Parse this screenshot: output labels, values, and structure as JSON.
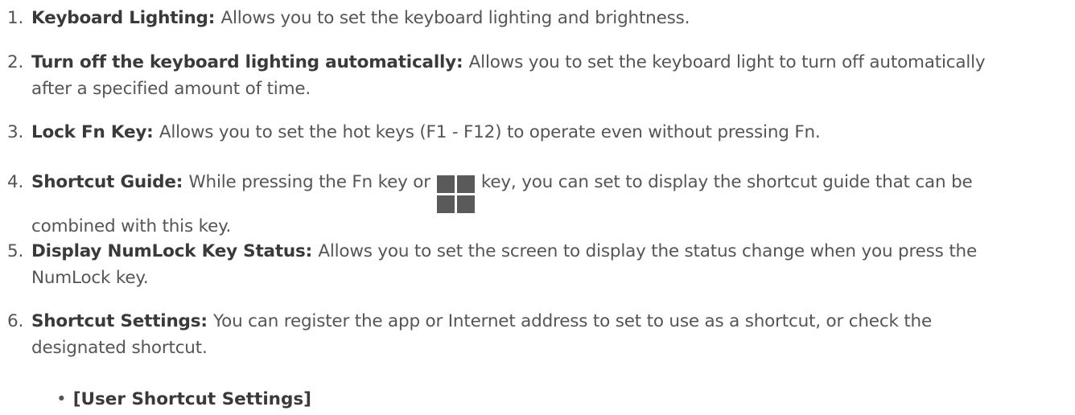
{
  "items": [
    {
      "num": "1.",
      "term": "Keyboard Lighting",
      "sep": ": ",
      "desc": "Allows you to set the keyboard lighting and brightness."
    },
    {
      "num": "2.",
      "term": "Turn off the keyboard lighting automatically",
      "sep": ": ",
      "desc1": "Allows you to set the keyboard light to turn off automatically",
      "desc2": "after a specified amount of time."
    },
    {
      "num": "3.",
      "term": "Lock Fn Key",
      "sep": ": ",
      "desc": "Allows you to set the hot keys (F1 - F12) to operate even without pressing Fn."
    },
    {
      "num": "4.",
      "term": "Shortcut Guide",
      "sep": ": ",
      "desc_a": "While pressing the Fn key or",
      "desc_b": "key, you can set to display the shortcut guide that can be",
      "desc2": "combined with this key.",
      "icon": "windows-key-icon"
    },
    {
      "num": "5.",
      "term": "Display NumLock Key Status",
      "sep": ": ",
      "desc1": "Allows you to set the screen to display the status change when you press the",
      "desc2": "NumLock key."
    },
    {
      "num": "6.",
      "term": "Shortcut Settings",
      "sep": ": ",
      "desc1": "You can register the app or Internet address to set to use as a shortcut, or check the",
      "desc2": "designated shortcut."
    }
  ],
  "sub_items": [
    {
      "bullet": "•",
      "label": "[User Shortcut Settings]"
    }
  ]
}
